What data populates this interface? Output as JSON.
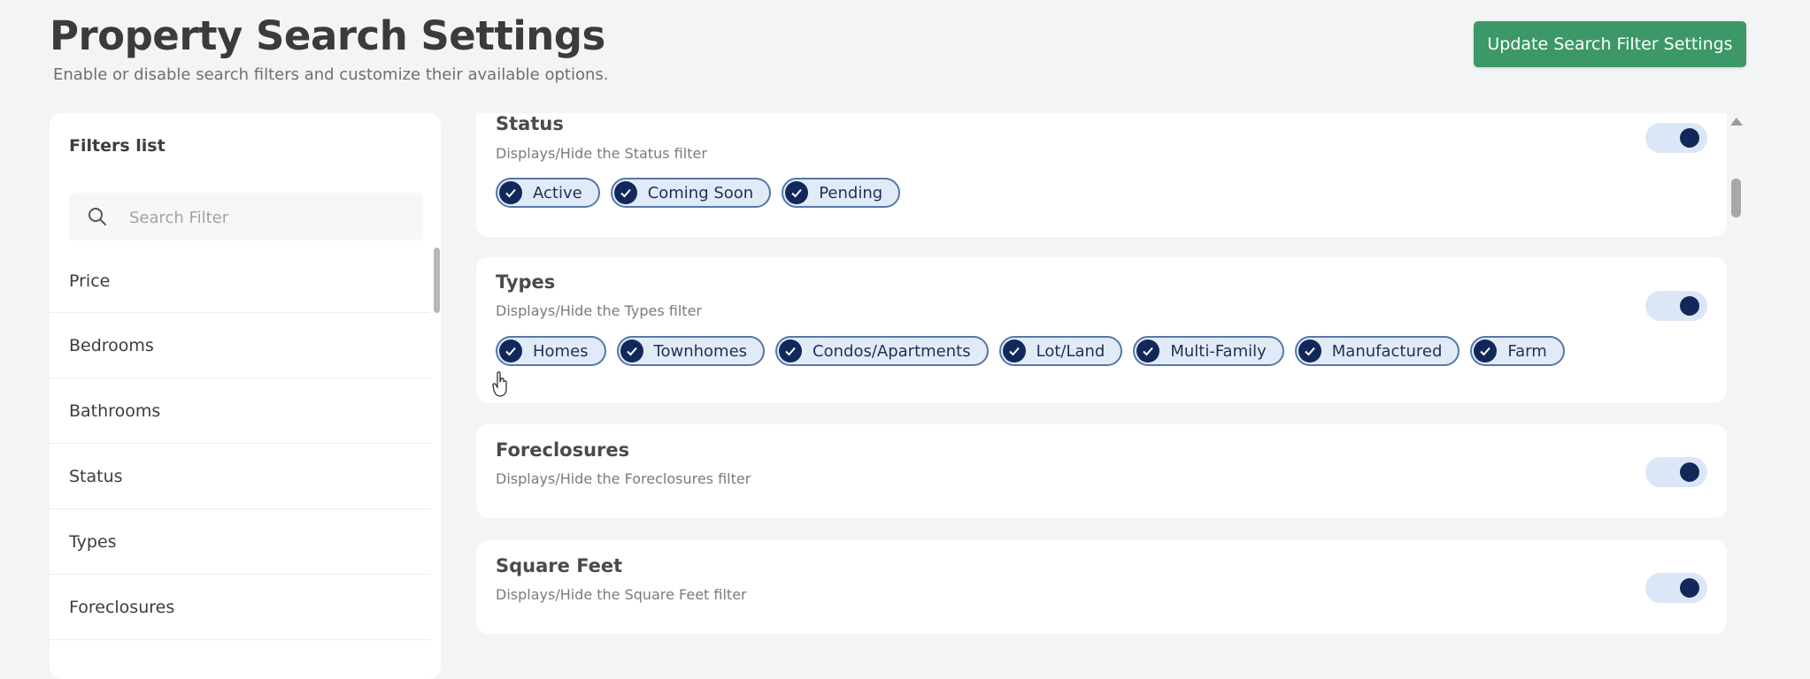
{
  "header": {
    "title": "Property Search Settings",
    "subtitle": "Enable or disable search filters and customize their available options.",
    "update_button": "Update Search Filter Settings"
  },
  "colors": {
    "accent_green": "#3c9866",
    "toggle_on_knob": "#13285a",
    "chip_border": "#5677a9"
  },
  "sidebar": {
    "title": "Filters list",
    "search_placeholder": "Search Filter",
    "search_icon": "search-icon",
    "items": [
      "Price",
      "Bedrooms",
      "Bathrooms",
      "Status",
      "Types",
      "Foreclosures"
    ]
  },
  "cards": [
    {
      "title": "Status",
      "description": "Displays/Hide the Status filter",
      "enabled": true,
      "options": [
        "Active",
        "Coming Soon",
        "Pending"
      ]
    },
    {
      "title": "Types",
      "description": "Displays/Hide the Types filter",
      "enabled": true,
      "options": [
        "Homes",
        "Townhomes",
        "Condos/Apartments",
        "Lot/Land",
        "Multi-Family",
        "Manufactured",
        "Farm"
      ]
    },
    {
      "title": "Foreclosures",
      "description": "Displays/Hide the Foreclosures filter",
      "enabled": true,
      "options": []
    },
    {
      "title": "Square Feet",
      "description": "Displays/Hide the Square Feet filter",
      "enabled": true,
      "options": []
    }
  ]
}
